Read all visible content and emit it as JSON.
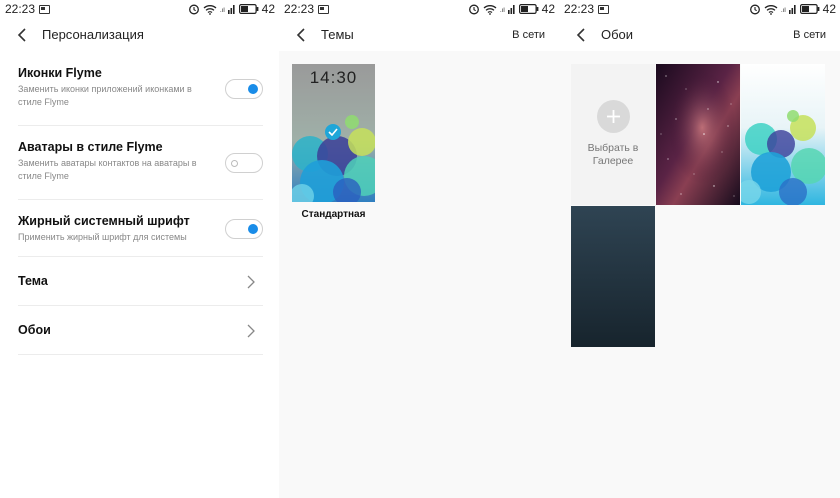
{
  "status_bar": {
    "time": "22:23",
    "battery": "42"
  },
  "personalization": {
    "title": "Персонализация",
    "items": [
      {
        "title": "Иконки Flyme",
        "subtitle": "Заменить иконки приложений иконками в стиле Flyme",
        "state": "on"
      },
      {
        "title": "Аватары в стиле Flyme",
        "subtitle": "Заменить аватары контактов на аватары в стиле Flyme",
        "state": "off"
      },
      {
        "title": "Жирный системный шрифт",
        "subtitle": "Применить жирный шрифт для системы",
        "state": "on"
      }
    ],
    "nav_items": [
      {
        "title": "Тема"
      },
      {
        "title": "Обои"
      }
    ]
  },
  "themes": {
    "title": "Темы",
    "online_label": "В сети",
    "items": [
      {
        "name": "Стандартная",
        "clock": "14:30",
        "selected": true
      }
    ]
  },
  "wallpapers": {
    "title": "Обои",
    "online_label": "В сети",
    "gallery_label": "Выбрать в Галерее"
  },
  "colors": {
    "accent": "#198ce8",
    "check": "#1fa6d8"
  }
}
